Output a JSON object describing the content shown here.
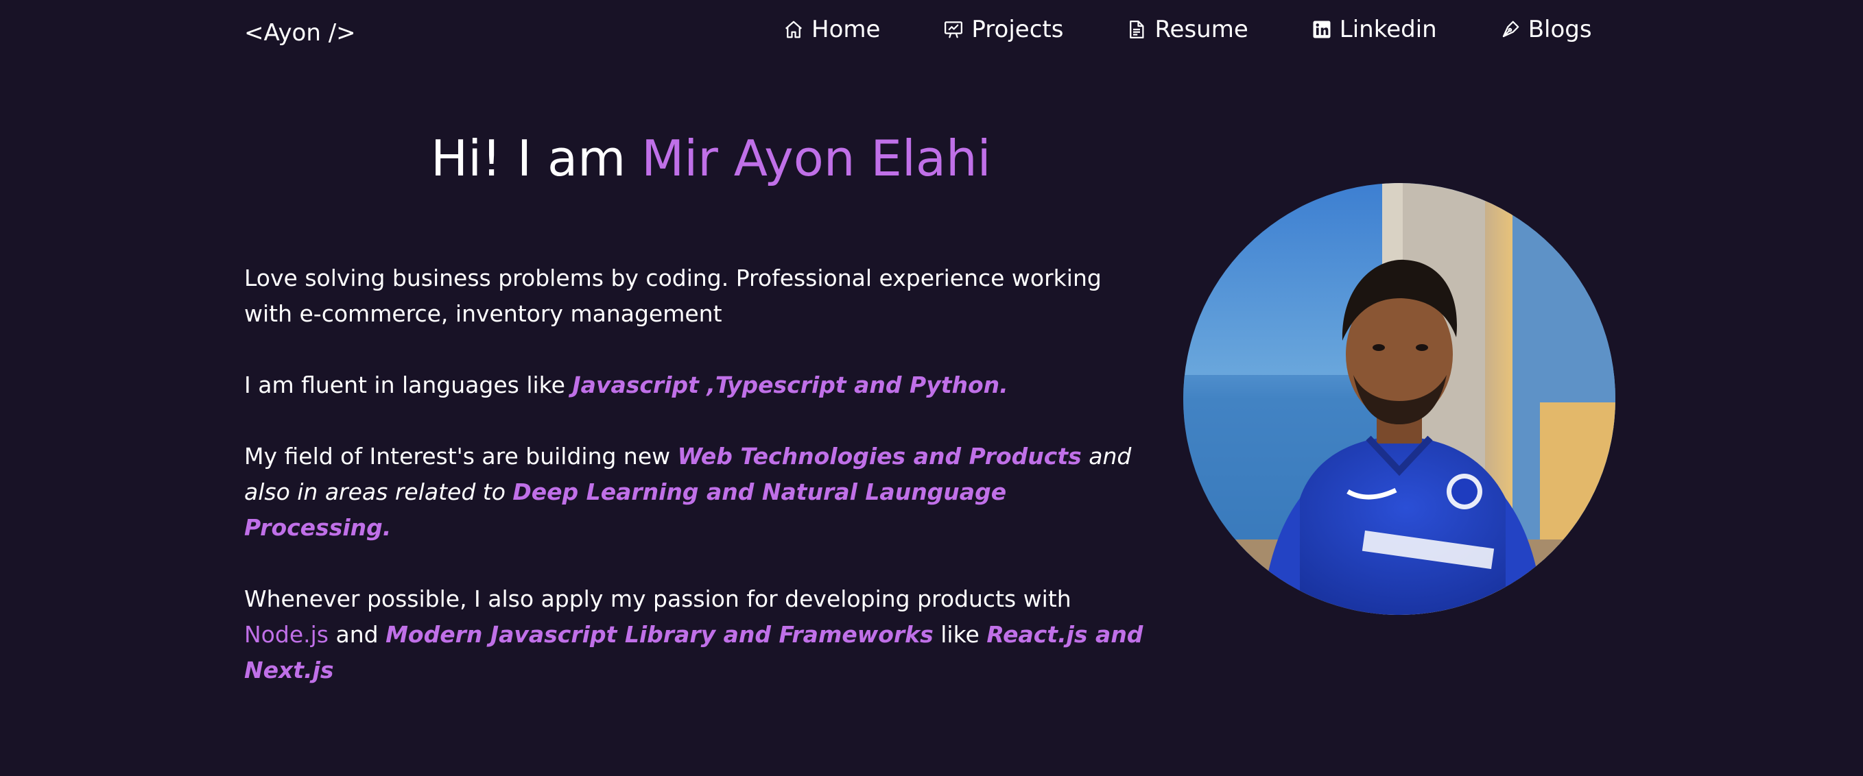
{
  "header": {
    "logo": "<Ayon />"
  },
  "nav": {
    "items": [
      {
        "label": "Home",
        "icon": "home-icon"
      },
      {
        "label": "Projects",
        "icon": "presentation-icon"
      },
      {
        "label": "Resume",
        "icon": "document-icon"
      },
      {
        "label": "Linkedin",
        "icon": "linkedin-icon"
      },
      {
        "label": "Blogs",
        "icon": "pen-nib-icon"
      }
    ]
  },
  "hero": {
    "greeting": "Hi! I am ",
    "name": "Mir Ayon Elahi"
  },
  "about": {
    "p1": "Love solving business problems by coding. Professional experience working with e-commerce, inventory management",
    "p2_prefix": "I am fluent in languages like ",
    "p2_languages": "Javascript ,Typescript and Python.",
    "p3_prefix": "My field of Interest's are building new ",
    "p3_interest1": "Web Technologies and Products",
    "p3_middle": " and also in areas related to ",
    "p3_interest2": "Deep Learning and Natural Launguage Processing.",
    "p4_prefix": "Whenever possible, I also apply my passion for developing products with ",
    "p4_node": "Node.js",
    "p4_and": " and ",
    "p4_libraries": "Modern Javascript Library and Frameworks",
    "p4_like": " like ",
    "p4_frameworks": "React.js and Next.js"
  },
  "profile_image": {
    "icon": "profile-photo"
  },
  "colors": {
    "background": "#181226",
    "accent": "#c070e8",
    "text": "#ffffff"
  }
}
